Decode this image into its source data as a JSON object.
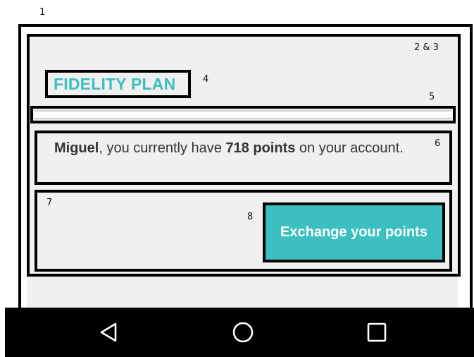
{
  "annotations": {
    "label_1": "1",
    "label_2_3": "2 & 3",
    "label_4": "4",
    "label_5": "5",
    "label_6": "6",
    "label_7": "7",
    "label_8": "8"
  },
  "header": {
    "title": "FIDELITY PLAN"
  },
  "points_message": {
    "user_name": "Miguel",
    "text_before_points": ", you currently have ",
    "points": "718 points",
    "text_after_points": " on your account."
  },
  "actions": {
    "exchange_label": "Exchange your points"
  },
  "navigation": {
    "icons": [
      "back-icon",
      "home-icon",
      "recents-icon"
    ]
  },
  "colors": {
    "accent": "#3bbfc1",
    "screen_background": "#f0f0f0",
    "navbar": "#000000"
  }
}
